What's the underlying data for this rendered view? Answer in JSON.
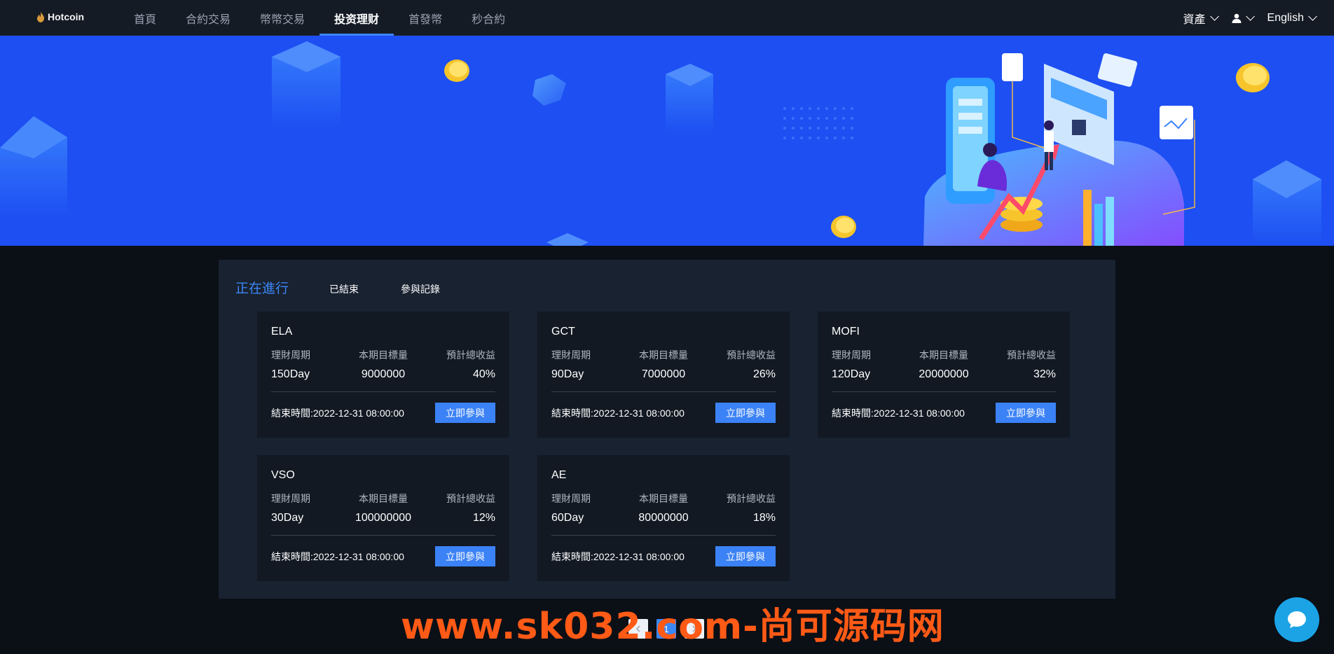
{
  "header": {
    "brand": "Hotcoin",
    "nav": [
      {
        "label": "首頁",
        "active": false
      },
      {
        "label": "合約交易",
        "active": false
      },
      {
        "label": "幣幣交易",
        "active": false
      },
      {
        "label": "投资理财",
        "active": true
      },
      {
        "label": "首發幣",
        "active": false
      },
      {
        "label": "秒合約",
        "active": false
      }
    ],
    "assets_label": "資產",
    "language_label": "English"
  },
  "tabs": [
    {
      "label": "正在進行",
      "active": true
    },
    {
      "label": "已結束",
      "active": false
    },
    {
      "label": "參與記錄",
      "active": false
    }
  ],
  "card_labels": {
    "period": "理財周期",
    "target": "本期目標量",
    "yield": "預計總收益",
    "end_time": "結束時間:",
    "join": "立即參與"
  },
  "products": [
    {
      "name": "ELA",
      "period": "150Day",
      "target": "9000000",
      "yield": "40%",
      "end_time": "2022-12-31 08:00:00"
    },
    {
      "name": "GCT",
      "period": "90Day",
      "target": "7000000",
      "yield": "26%",
      "end_time": "2022-12-31 08:00:00"
    },
    {
      "name": "MOFI",
      "period": "120Day",
      "target": "20000000",
      "yield": "32%",
      "end_time": "2022-12-31 08:00:00"
    },
    {
      "name": "VSO",
      "period": "30Day",
      "target": "100000000",
      "yield": "12%",
      "end_time": "2022-12-31 08:00:00"
    },
    {
      "name": "AE",
      "period": "60Day",
      "target": "80000000",
      "yield": "18%",
      "end_time": "2022-12-31 08:00:00"
    }
  ],
  "pagination": {
    "current": "1"
  },
  "watermark": "www.sk032.com-尚可源码网",
  "colors": {
    "accent": "#3b87f5",
    "banner": "#1d4ff2",
    "panel": "#192230",
    "card": "#121923",
    "watermark": "#ff5a16"
  },
  "icons": [
    "flame-logo-icon",
    "chevron-down-icon",
    "user-icon",
    "chat-bubble-icon"
  ]
}
